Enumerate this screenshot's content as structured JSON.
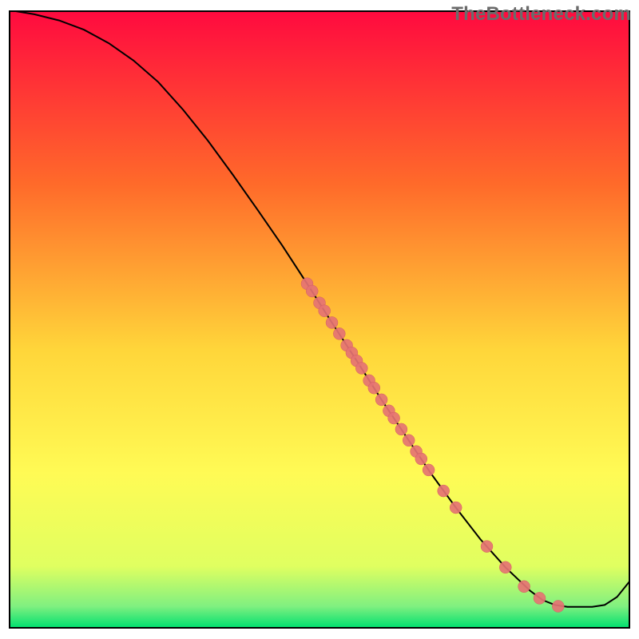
{
  "watermark": "TheBottleneck.com",
  "colors": {
    "gradient_top": "#ff0a3f",
    "gradient_mid_upper": "#ff8a2a",
    "gradient_mid": "#ffe63a",
    "gradient_lower": "#f0ff5a",
    "gradient_bottom": "#00e070",
    "line": "#000000",
    "point_fill": "#e57373",
    "point_stroke": "#d46060",
    "border": "#000000"
  },
  "chart_data": {
    "type": "line",
    "title": "",
    "xlabel": "",
    "ylabel": "",
    "xlim": [
      0,
      100
    ],
    "ylim": [
      0,
      100
    ],
    "curve": [
      {
        "x": 1,
        "y": 100
      },
      {
        "x": 4,
        "y": 99.5
      },
      {
        "x": 8,
        "y": 98.5
      },
      {
        "x": 12,
        "y": 97
      },
      {
        "x": 16,
        "y": 94.8
      },
      {
        "x": 20,
        "y": 92
      },
      {
        "x": 24,
        "y": 88.5
      },
      {
        "x": 28,
        "y": 84
      },
      {
        "x": 32,
        "y": 79
      },
      {
        "x": 36,
        "y": 73.5
      },
      {
        "x": 40,
        "y": 67.8
      },
      {
        "x": 44,
        "y": 62
      },
      {
        "x": 48,
        "y": 55.8
      },
      {
        "x": 52,
        "y": 49.5
      },
      {
        "x": 56,
        "y": 43.3
      },
      {
        "x": 60,
        "y": 37
      },
      {
        "x": 64,
        "y": 31
      },
      {
        "x": 68,
        "y": 25
      },
      {
        "x": 72,
        "y": 19.5
      },
      {
        "x": 76,
        "y": 14.3
      },
      {
        "x": 80,
        "y": 9.8
      },
      {
        "x": 84,
        "y": 6
      },
      {
        "x": 86,
        "y": 4.5
      },
      {
        "x": 88,
        "y": 3.7
      },
      {
        "x": 90,
        "y": 3.4
      },
      {
        "x": 92,
        "y": 3.4
      },
      {
        "x": 94,
        "y": 3.4
      },
      {
        "x": 96,
        "y": 3.7
      },
      {
        "x": 98,
        "y": 5
      },
      {
        "x": 100,
        "y": 7.5
      }
    ],
    "points": [
      {
        "x": 48.0,
        "y": 55.8
      },
      {
        "x": 48.8,
        "y": 54.6
      },
      {
        "x": 50.0,
        "y": 52.7
      },
      {
        "x": 50.8,
        "y": 51.4
      },
      {
        "x": 52.0,
        "y": 49.5
      },
      {
        "x": 53.2,
        "y": 47.7
      },
      {
        "x": 54.4,
        "y": 45.8
      },
      {
        "x": 55.2,
        "y": 44.6
      },
      {
        "x": 56.0,
        "y": 43.3
      },
      {
        "x": 56.8,
        "y": 42.1
      },
      {
        "x": 58.0,
        "y": 40.1
      },
      {
        "x": 58.8,
        "y": 38.9
      },
      {
        "x": 60.0,
        "y": 37.0
      },
      {
        "x": 61.2,
        "y": 35.2
      },
      {
        "x": 62.0,
        "y": 34.0
      },
      {
        "x": 63.2,
        "y": 32.2
      },
      {
        "x": 64.4,
        "y": 30.4
      },
      {
        "x": 65.6,
        "y": 28.6
      },
      {
        "x": 66.4,
        "y": 27.4
      },
      {
        "x": 67.6,
        "y": 25.6
      },
      {
        "x": 70.0,
        "y": 22.2
      },
      {
        "x": 72.0,
        "y": 19.5
      },
      {
        "x": 77.0,
        "y": 13.2
      },
      {
        "x": 80.0,
        "y": 9.8
      },
      {
        "x": 83.0,
        "y": 6.7
      },
      {
        "x": 85.5,
        "y": 4.8
      },
      {
        "x": 88.5,
        "y": 3.5
      }
    ]
  }
}
